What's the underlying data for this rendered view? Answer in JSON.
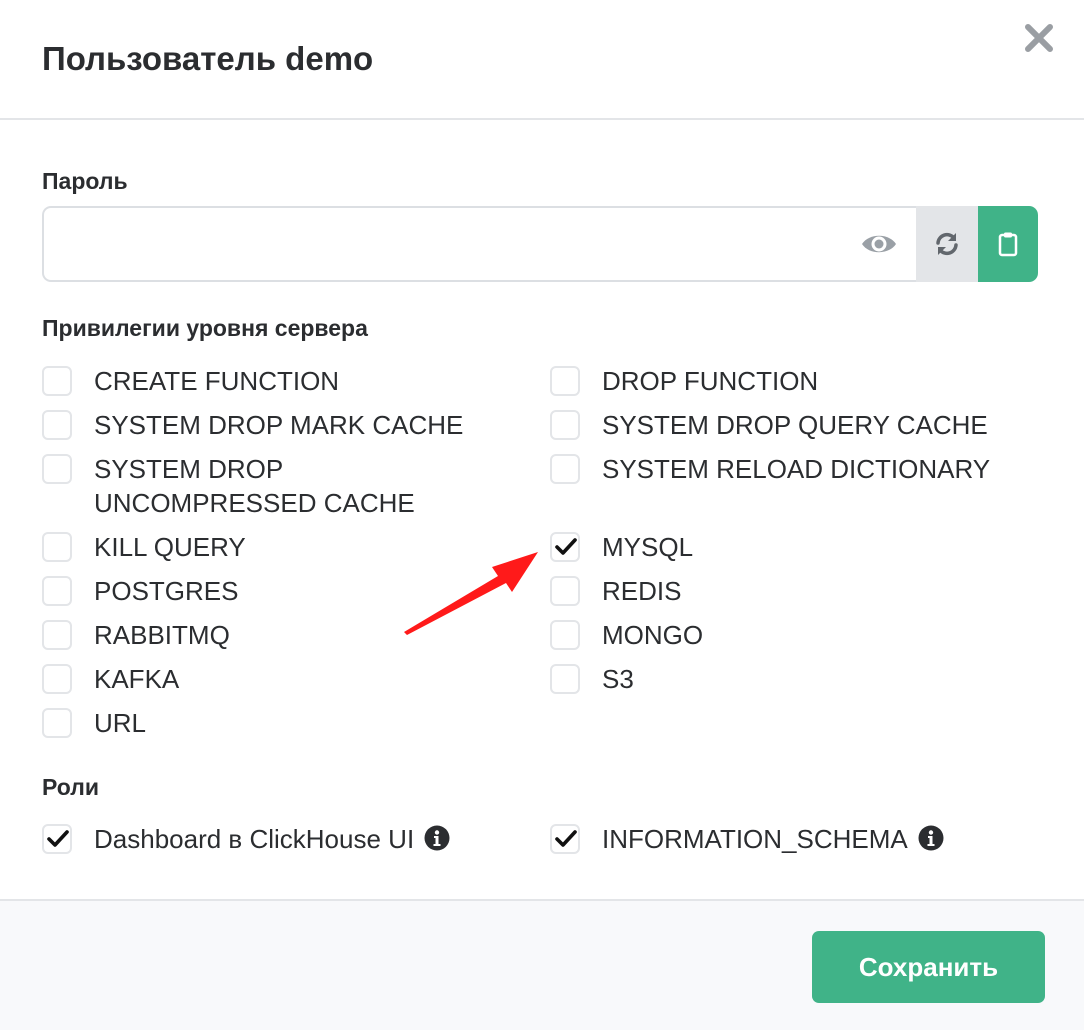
{
  "header": {
    "title": "Пользователь demo"
  },
  "password": {
    "label": "Пароль",
    "value": "",
    "placeholder": ""
  },
  "privileges": {
    "label": "Привилегии уровня сервера",
    "left": [
      {
        "label": "CREATE FUNCTION",
        "checked": false
      },
      {
        "label": "SYSTEM DROP MARK CACHE",
        "checked": false
      },
      {
        "label": "SYSTEM DROP",
        "label2": "UNCOMPRESSED CACHE",
        "checked": false
      },
      {
        "label": "KILL QUERY",
        "checked": false
      },
      {
        "label": "POSTGRES",
        "checked": false
      },
      {
        "label": "RABBITMQ",
        "checked": false
      },
      {
        "label": "KAFKA",
        "checked": false
      },
      {
        "label": "URL",
        "checked": false
      }
    ],
    "right": [
      {
        "label": "DROP FUNCTION",
        "checked": false
      },
      {
        "label": "SYSTEM DROP QUERY CACHE",
        "checked": false
      },
      {
        "label": "SYSTEM RELOAD DICTIONARY",
        "checked": false
      },
      {
        "label": "MYSQL",
        "checked": true
      },
      {
        "label": "REDIS",
        "checked": false
      },
      {
        "label": "MONGO",
        "checked": false
      },
      {
        "label": "S3",
        "checked": false
      }
    ]
  },
  "roles": {
    "label": "Роли",
    "items": [
      {
        "label": "Dashboard в ClickHouse UI",
        "checked": true
      },
      {
        "label": "INFORMATION_SCHEMA",
        "checked": true
      }
    ]
  },
  "footer": {
    "save_label": "Сохранить"
  },
  "colors": {
    "accent": "#40b388",
    "annotation_arrow": "#ff1a1a"
  }
}
